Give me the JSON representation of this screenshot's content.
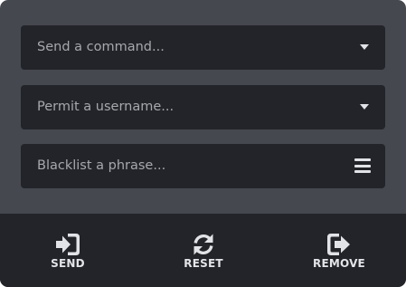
{
  "fields": [
    {
      "placeholder": "Send a command...",
      "control": "dropdown-caret"
    },
    {
      "placeholder": "Permit a username...",
      "control": "dropdown-caret"
    },
    {
      "placeholder": "Blacklist a phrase...",
      "control": "list-menu"
    }
  ],
  "actions": [
    {
      "label": "SEND",
      "icon": "sign-in-icon"
    },
    {
      "label": "RESET",
      "icon": "refresh-icon"
    },
    {
      "label": "REMOVE",
      "icon": "sign-out-icon"
    }
  ],
  "colors": {
    "panel_bg": "#45484f",
    "field_bg": "#232429",
    "toolbar_bg": "#232429",
    "placeholder_text": "#a6a8ad",
    "icon": "#e2e3e6"
  }
}
